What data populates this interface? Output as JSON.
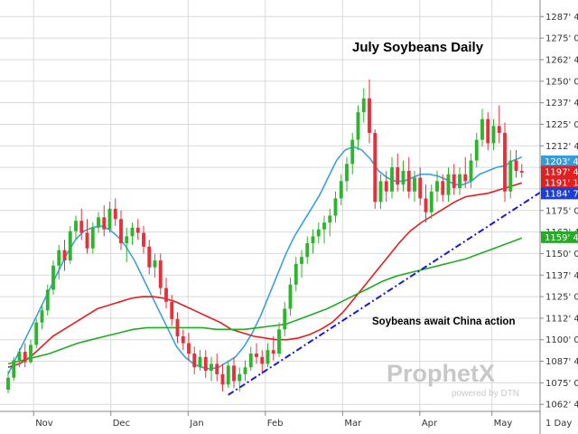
{
  "chart_data": {
    "type": "candlestick",
    "title": "July Soybeans Daily",
    "annotation": "Soybeans await China action",
    "x_labels": [
      "Nov",
      "Dec",
      "Jan",
      "Feb",
      "Mar",
      "Apr",
      "May"
    ],
    "y_ticks": [
      "1287' 4",
      "1275' 0",
      "1262' 4",
      "1250' 0",
      "1237' 4",
      "1225' 0",
      "1212' 4",
      "1200' 0",
      "1187' 4",
      "1175' 0",
      "1162' 4",
      "1150' 0",
      "1137' 4",
      "1125' 0",
      "1112' 4",
      "1100' 0",
      "1087' 4",
      "1075' 0",
      "1062' 4"
    ],
    "ylim": [
      1060,
      1295
    ],
    "price_tags": [
      {
        "label": "1203' 4",
        "value": 1203.5,
        "color": "#3a9bd5"
      },
      {
        "label": "1197' 4",
        "value": 1197.5,
        "color": "#e02020"
      },
      {
        "label": "1191' 1",
        "value": 1191.1,
        "color": "#e02020"
      },
      {
        "label": "1184' 7",
        "value": 1184.9,
        "color": "#1a3fd6"
      },
      {
        "label": "1159' 4",
        "value": 1159.5,
        "color": "#2aa82a"
      }
    ],
    "period_label": "1 Day",
    "watermark": {
      "brand": "ProphetX",
      "sub": "powered by DTN"
    },
    "colors": {
      "up": "#2db52d",
      "down": "#e8303a",
      "ma_fast": "#3aa0e0",
      "ma_mid": "#e02020",
      "ma_slow": "#22aa22",
      "trend": "#1a1ad6",
      "grid": "#d9d9d9"
    },
    "series": [
      {
        "name": "",
        "values": [
          [
            1071,
            1082,
            1069,
            1078
          ],
          [
            1078,
            1090,
            1076,
            1088
          ],
          [
            1088,
            1095,
            1084,
            1093
          ],
          [
            1093,
            1098,
            1084,
            1087
          ],
          [
            1087,
            1100,
            1086,
            1097
          ],
          [
            1097,
            1112,
            1095,
            1110
          ],
          [
            1110,
            1120,
            1106,
            1117
          ],
          [
            1117,
            1132,
            1114,
            1129
          ],
          [
            1129,
            1146,
            1126,
            1143
          ],
          [
            1143,
            1155,
            1135,
            1152
          ],
          [
            1152,
            1158,
            1140,
            1146
          ],
          [
            1146,
            1166,
            1144,
            1163
          ],
          [
            1163,
            1172,
            1158,
            1169
          ],
          [
            1169,
            1176,
            1158,
            1162
          ],
          [
            1162,
            1170,
            1150,
            1153
          ],
          [
            1153,
            1168,
            1150,
            1165
          ],
          [
            1165,
            1174,
            1162,
            1171
          ],
          [
            1171,
            1178,
            1160,
            1164
          ],
          [
            1164,
            1180,
            1162,
            1176
          ],
          [
            1176,
            1182,
            1166,
            1170
          ],
          [
            1170,
            1175,
            1152,
            1156
          ],
          [
            1156,
            1165,
            1145,
            1160
          ],
          [
            1160,
            1168,
            1155,
            1165
          ],
          [
            1165,
            1170,
            1158,
            1162
          ],
          [
            1162,
            1166,
            1150,
            1154
          ],
          [
            1154,
            1158,
            1138,
            1142
          ],
          [
            1142,
            1150,
            1136,
            1146
          ],
          [
            1146,
            1150,
            1126,
            1130
          ],
          [
            1130,
            1136,
            1118,
            1122
          ],
          [
            1122,
            1126,
            1108,
            1112
          ],
          [
            1112,
            1116,
            1098,
            1102
          ],
          [
            1102,
            1106,
            1094,
            1098
          ],
          [
            1098,
            1104,
            1088,
            1092
          ],
          [
            1092,
            1096,
            1080,
            1084
          ],
          [
            1084,
            1094,
            1082,
            1090
          ],
          [
            1090,
            1094,
            1078,
            1082
          ],
          [
            1082,
            1090,
            1076,
            1086
          ],
          [
            1086,
            1092,
            1076,
            1080
          ],
          [
            1080,
            1086,
            1070,
            1074
          ],
          [
            1074,
            1088,
            1072,
            1085
          ],
          [
            1085,
            1090,
            1072,
            1076
          ],
          [
            1076,
            1084,
            1070,
            1080
          ],
          [
            1080,
            1088,
            1076,
            1084
          ],
          [
            1084,
            1096,
            1082,
            1092
          ],
          [
            1092,
            1098,
            1086,
            1090
          ],
          [
            1090,
            1094,
            1080,
            1086
          ],
          [
            1086,
            1098,
            1084,
            1094
          ],
          [
            1094,
            1102,
            1088,
            1092
          ],
          [
            1092,
            1110,
            1090,
            1106
          ],
          [
            1106,
            1122,
            1102,
            1118
          ],
          [
            1118,
            1136,
            1114,
            1132
          ],
          [
            1132,
            1148,
            1128,
            1144
          ],
          [
            1144,
            1152,
            1136,
            1148
          ],
          [
            1148,
            1160,
            1144,
            1156
          ],
          [
            1156,
            1164,
            1150,
            1160
          ],
          [
            1160,
            1168,
            1156,
            1164
          ],
          [
            1164,
            1172,
            1156,
            1168
          ],
          [
            1168,
            1176,
            1160,
            1172
          ],
          [
            1172,
            1186,
            1168,
            1182
          ],
          [
            1182,
            1196,
            1178,
            1192
          ],
          [
            1192,
            1206,
            1186,
            1202
          ],
          [
            1202,
            1220,
            1196,
            1216
          ],
          [
            1216,
            1236,
            1210,
            1232
          ],
          [
            1232,
            1246,
            1226,
            1240
          ],
          [
            1240,
            1251,
            1214,
            1220
          ],
          [
            1220,
            1222,
            1176,
            1180
          ],
          [
            1180,
            1196,
            1176,
            1192
          ],
          [
            1192,
            1198,
            1180,
            1186
          ],
          [
            1186,
            1206,
            1182,
            1200
          ],
          [
            1200,
            1208,
            1186,
            1190
          ],
          [
            1190,
            1204,
            1186,
            1198
          ],
          [
            1198,
            1206,
            1182,
            1186
          ],
          [
            1186,
            1198,
            1180,
            1194
          ],
          [
            1194,
            1200,
            1178,
            1182
          ],
          [
            1182,
            1190,
            1168,
            1174
          ],
          [
            1174,
            1190,
            1170,
            1186
          ],
          [
            1186,
            1198,
            1180,
            1192
          ],
          [
            1192,
            1196,
            1180,
            1184
          ],
          [
            1184,
            1200,
            1180,
            1196
          ],
          [
            1196,
            1202,
            1184,
            1188
          ],
          [
            1188,
            1200,
            1184,
            1196
          ],
          [
            1196,
            1206,
            1188,
            1192
          ],
          [
            1192,
            1208,
            1188,
            1204
          ],
          [
            1204,
            1220,
            1200,
            1216
          ],
          [
            1216,
            1234,
            1212,
            1228
          ],
          [
            1228,
            1232,
            1210,
            1214
          ],
          [
            1214,
            1228,
            1210,
            1224
          ],
          [
            1224,
            1236,
            1214,
            1220
          ],
          [
            1220,
            1226,
            1180,
            1186
          ],
          [
            1186,
            1210,
            1182,
            1204
          ],
          [
            1204,
            1210,
            1194,
            1198
          ],
          [
            1198,
            1202,
            1194,
            1197
          ]
        ]
      }
    ],
    "moving_averages": [
      {
        "name": "",
        "values": [
          1080,
          1090,
          1100,
          1110,
          1120,
          1130,
          1140,
          1150,
          1158,
          1163,
          1165,
          1166,
          1164,
          1160,
          1154,
          1146,
          1136,
          1126,
          1116,
          1106,
          1096,
          1090,
          1086,
          1084,
          1083,
          1084,
          1087,
          1090,
          1096,
          1104,
          1114,
          1126,
          1138,
          1150,
          1160,
          1168,
          1176,
          1184,
          1194,
          1204,
          1210,
          1212,
          1210,
          1205,
          1198,
          1194,
          1192,
          1192,
          1194,
          1196,
          1196,
          1195,
          1193,
          1190,
          1190,
          1192,
          1196,
          1198,
          1200,
          1201,
          1204,
          1206
        ]
      },
      {
        "name": "",
        "values": [
          1084,
          1086,
          1090,
          1096,
          1102,
          1106,
          1110,
          1114,
          1118,
          1120,
          1122,
          1124,
          1125,
          1125,
          1124,
          1122,
          1119,
          1116,
          1113,
          1110,
          1106,
          1104,
          1102,
          1101,
          1100,
          1100,
          1101,
          1103,
          1106,
          1110,
          1116,
          1124,
          1132,
          1140,
          1148,
          1156,
          1163,
          1168,
          1172,
          1176,
          1180,
          1183,
          1184,
          1185,
          1187,
          1189,
          1191
        ]
      },
      {
        "name": "",
        "values": [
          1086,
          1088,
          1090,
          1092,
          1095,
          1098,
          1100,
          1102,
          1104,
          1106,
          1107,
          1107,
          1107,
          1107,
          1107,
          1106,
          1106,
          1106,
          1107,
          1108,
          1109,
          1112,
          1115,
          1118,
          1122,
          1126,
          1130,
          1134,
          1137,
          1139,
          1141,
          1143,
          1145,
          1147,
          1150,
          1153,
          1156,
          1159
        ]
      }
    ],
    "trendline": {
      "from": [
        39,
        1068
      ],
      "to": [
        94,
        1184
      ]
    }
  }
}
